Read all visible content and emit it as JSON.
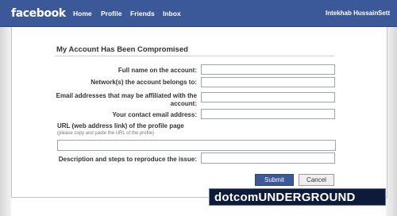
{
  "header": {
    "logo": "facebook",
    "nav": [
      "Home",
      "Profile",
      "Friends",
      "Inbox"
    ],
    "user_name": "Intekhab Hussain",
    "settings_partial": "Sett"
  },
  "form": {
    "title": "My Account Has Been Compromised",
    "fields": {
      "full_name_label": "Full name on the account:",
      "networks_label": "Network(s) the account belongs to:",
      "emails_label": "Email addresses that may be affiliated with the account:",
      "contact_email_label": "Your contact email address:",
      "url_label": "URL (web address link) of the profile page",
      "url_hint": "(please copy and paste the URL of the profile)",
      "description_label": "Description and steps to reproduce the issue:"
    },
    "buttons": {
      "submit": "Submit",
      "cancel": "Cancel"
    }
  },
  "watermark": {
    "text": "dotcomUNDERGROUND .com"
  },
  "colors": {
    "brand_blue": "#3b5998"
  }
}
